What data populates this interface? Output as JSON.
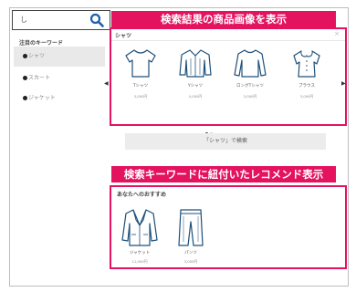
{
  "search": {
    "value": "し"
  },
  "keywords": {
    "title": "注目のキーワード",
    "items": [
      {
        "label": "シャツ",
        "active": true
      },
      {
        "label": "スカート",
        "active": false
      },
      {
        "label": "ジャケット",
        "active": false
      }
    ]
  },
  "banners": {
    "top": "検索結果の商品画像を表示",
    "bottom": "検索キーワードに紐付いたレコメンド表示"
  },
  "results": {
    "title": "シャツ",
    "close": "×",
    "products": [
      {
        "name": "Tシャツ",
        "price": "3,000円",
        "icon": "tshirt-icon"
      },
      {
        "name": "Yシャツ",
        "price": "4,000円",
        "icon": "dress-shirt-icon"
      },
      {
        "name": "ロングTシャツ",
        "price": "3,000円",
        "icon": "long-tshirt-icon"
      },
      {
        "name": "ブラウス",
        "price": "3,000円",
        "icon": "blouse-icon"
      }
    ],
    "prev": "◀",
    "next": "▶"
  },
  "search_button": "「シャツ」で検索",
  "recommend": {
    "title": "あなたへのおすすめ",
    "items": [
      {
        "name": "ジャケット",
        "price": "11,000円",
        "icon": "jacket-icon"
      },
      {
        "name": "パンツ",
        "price": "3,000円",
        "icon": "pants-icon"
      }
    ]
  },
  "colors": {
    "accent": "#e3135f",
    "search_icon": "#1f5fa8"
  }
}
